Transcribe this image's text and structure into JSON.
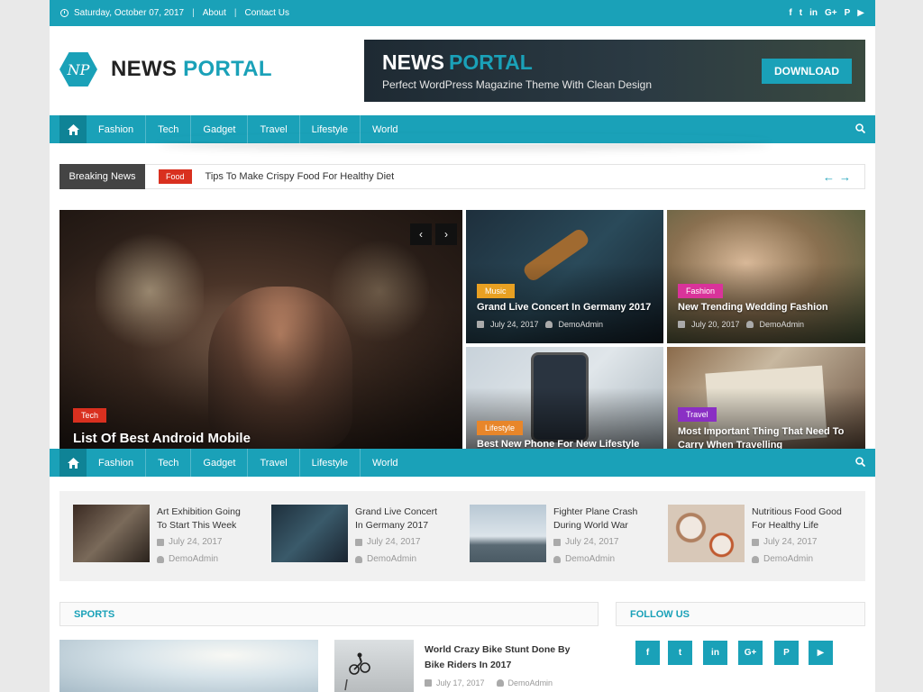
{
  "topbar": {
    "date": "Saturday, October 07, 2017",
    "links": [
      "About",
      "Contact Us"
    ],
    "social": [
      "f",
      "t",
      "in",
      "G+",
      "P",
      "▶"
    ]
  },
  "logo": {
    "mark": "NP",
    "name_part1": "NEWS",
    "name_part2": "PORTAL"
  },
  "banner": {
    "title_part1": "NEWS",
    "title_part2": "PORTAL",
    "subtitle": "Perfect WordPress Magazine Theme With Clean Design",
    "button": "DOWNLOAD"
  },
  "nav": {
    "items": [
      "Fashion",
      "Tech",
      "Gadget",
      "Travel",
      "Lifestyle",
      "World"
    ]
  },
  "breaking": {
    "label": "Breaking News",
    "badge": "Food",
    "headline": "Tips To Make Crispy Food For Healthy Diet",
    "arrows": "←→"
  },
  "hero": {
    "main": {
      "category": "Tech",
      "title": "List Of Best Android Mobile"
    },
    "tiles": [
      {
        "category": "Music",
        "title": "Grand Live Concert In Germany 2017",
        "date": "July 24, 2017",
        "author": "DemoAdmin"
      },
      {
        "category": "Fashion",
        "title": "New Trending Wedding Fashion",
        "date": "July 20, 2017",
        "author": "DemoAdmin"
      },
      {
        "category": "Lifestyle",
        "title": "Best New Phone For New Lifestyle"
      },
      {
        "category": "Travel",
        "title": "Most Important Thing That Need To Carry When Travelling"
      }
    ]
  },
  "recent": [
    {
      "title": "Art Exhibition Going To Start This Week",
      "date": "July 24, 2017",
      "author": "DemoAdmin"
    },
    {
      "title": "Grand Live Concert In Germany 2017",
      "date": "July 24, 2017",
      "author": "DemoAdmin"
    },
    {
      "title": "Fighter Plane Crash During World War",
      "date": "July 24, 2017",
      "author": "DemoAdmin"
    },
    {
      "title": "Nutritious Food Good For Healthy Life",
      "date": "July 24, 2017",
      "author": "DemoAdmin"
    }
  ],
  "sports": {
    "heading": "SPORTS",
    "post": {
      "title": "World Crazy Bike Stunt Done By Bike Riders In 2017",
      "date": "July 17, 2017",
      "author": "DemoAdmin"
    }
  },
  "follow": {
    "heading": "FOLLOW US",
    "buttons": [
      "f",
      "t",
      "in",
      "G+",
      "P",
      "▶"
    ]
  },
  "colors": {
    "accent": "#1aa1b8",
    "breaking_badge": "#d9301f",
    "music": "#e8a022",
    "fashion": "#d9339a",
    "lifestyle": "#e8862a",
    "travel": "#8a2fc4",
    "tech": "#d9301f"
  }
}
